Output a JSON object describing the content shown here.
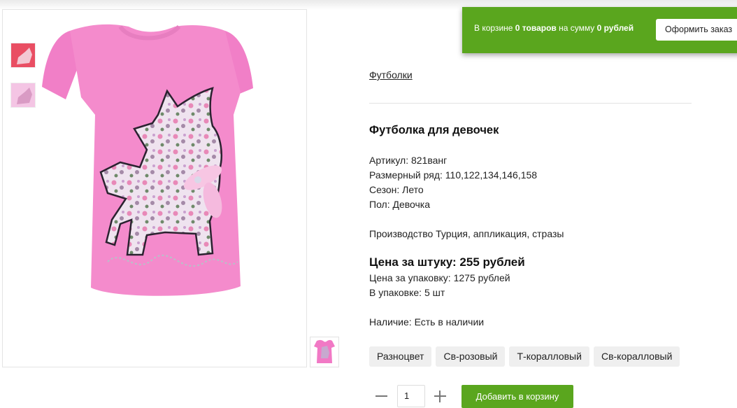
{
  "cart": {
    "prefix": "В корзине",
    "count": "0 товаров",
    "middle": "на сумму",
    "sum": "0 рублей",
    "checkout_label": "Оформить заказ"
  },
  "breadcrumb": {
    "category": "Футболки"
  },
  "product": {
    "title": "Футболка для девочек",
    "article": "Артикул: 821ванг",
    "sizes": "Размерный ряд: 110,122,134,146,158",
    "season": "Сезон: Лето",
    "gender": "Пол: Девочка",
    "description": "Производство Турция, аппликация, стразы",
    "price_unit": "Цена за штуку: 255 рублей",
    "price_pack": "Цена за упаковку: 1275 рублей",
    "pack_size": "В упаковке: 5 шт",
    "availability": "Наличие: Есть в наличии"
  },
  "colors": [
    "Разноцвет",
    "Св-розовый",
    "Т-коралловый",
    "Св-коралловый"
  ],
  "purchase": {
    "quantity": "1",
    "add_label": "Добавить в корзину"
  },
  "theme": {
    "accent": "#5aa61e",
    "shirt": "#f28fcf"
  }
}
